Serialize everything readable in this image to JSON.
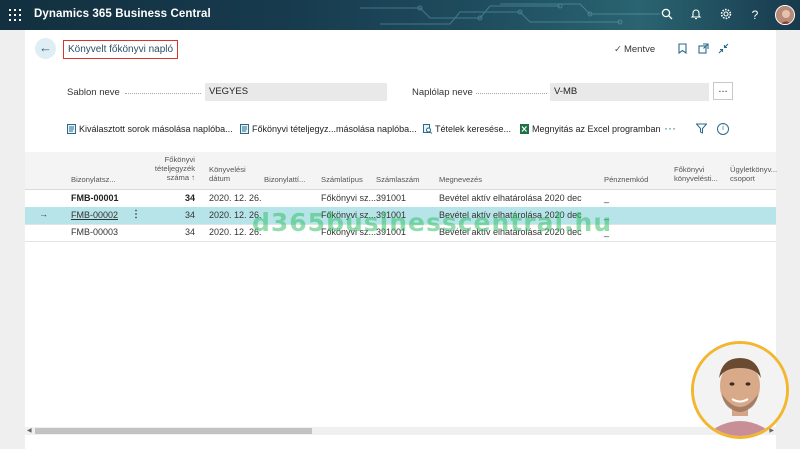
{
  "app": {
    "title": "Dynamics 365 Business Central"
  },
  "page": {
    "title": "Könyvelt főkönyvi napló",
    "saved_label": "Mentve"
  },
  "fields": {
    "template_label": "Sablon neve",
    "template_value": "VEGYES",
    "batch_label": "Naplólap neve",
    "batch_value": "V-MB",
    "more_label": "..."
  },
  "actions": [
    {
      "label": "Kiválasztott sorok másolása naplóba..."
    },
    {
      "label": "Főkönyvi tételjegyz...másolása naplóba..."
    },
    {
      "label": "Tételek keresése..."
    },
    {
      "label": "Megnyitás az Excel programban"
    }
  ],
  "more_actions": "···",
  "columns": [
    "Bizonylatsz...",
    "Főkönyvi tételjegyzék száma ↑",
    "Könyvelési dátum",
    "Bizonylattí...",
    "Számlatípus",
    "Számlaszám",
    "Megnevezés",
    "Pénznemkód",
    "Főkönyvi könyvelésti...",
    "Ügyletkönyv... csoport"
  ],
  "rows": [
    {
      "doc_no": "FMB-00001",
      "register_no": "34",
      "date": "2020. 12. 26.",
      "doc_type": "",
      "acct_type": "Főkönyvi sz...",
      "acct_no": "391001",
      "description": "Bevétel aktív elhatárolása 2020 dec",
      "currency": "_"
    },
    {
      "doc_no": "FMB-00002",
      "register_no": "34",
      "date": "2020. 12. 26.",
      "doc_type": "",
      "acct_type": "Főkönyvi sz...",
      "acct_no": "391001",
      "description": "Bevétel aktív elhatárolása 2020 dec",
      "currency": "_"
    },
    {
      "doc_no": "FMB-00003",
      "register_no": "34",
      "date": "2020. 12. 26.",
      "doc_type": "",
      "acct_type": "Főkönyvi sz...",
      "acct_no": "391001",
      "description": "Bevétel aktív elhatárolása 2020 dec",
      "currency": "_"
    }
  ],
  "watermark": "d365businesscentral.hu",
  "colors": {
    "topbar": "#173a4d",
    "selected_row": "#b7e4e8",
    "title_outline": "#d9332b",
    "avatar_ring": "#f2b630"
  }
}
